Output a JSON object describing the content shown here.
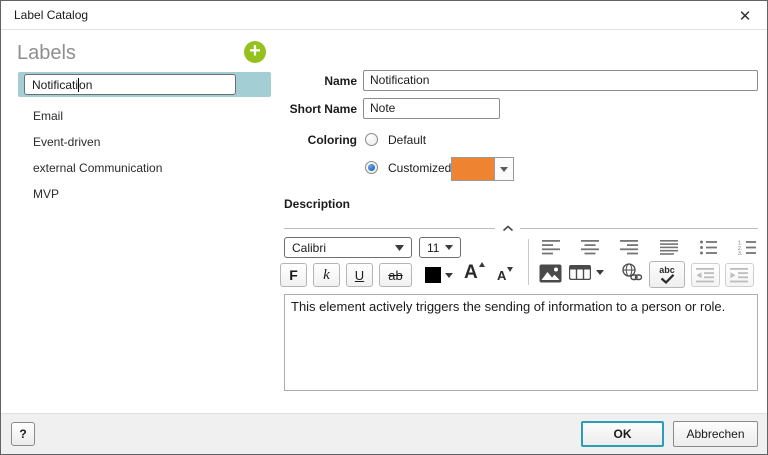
{
  "window": {
    "title": "Label Catalog",
    "close_glyph": "✕"
  },
  "labels_panel": {
    "heading": "Labels",
    "add_glyph": "+",
    "items": [
      "Notification",
      "Email",
      "Event-driven",
      "external Communication",
      "MVP"
    ],
    "selected_item": "Notification",
    "edit_value": "Notification",
    "edit_value_before_caret": "Notificati",
    "edit_value_after_caret": "on"
  },
  "form": {
    "name_label": "Name",
    "name_value": "Notification",
    "short_name_label": "Short Name",
    "short_name_value": "Note",
    "coloring_label": "Coloring",
    "default_option": "Default",
    "customized_option": "Customized",
    "selected_coloring": "Customized",
    "custom_color": "#ee8431",
    "custom_color_style": "background-color:#ee8431;",
    "description_label": "Description"
  },
  "editor": {
    "font_family_value": "Calibri",
    "font_size_value": "11",
    "bold_label": "F",
    "italic_label": "k",
    "underline_label": "U",
    "strikethrough_label": "ab",
    "increase_font_label": "A",
    "decrease_font_label": "A",
    "spellcheck_label": "abc",
    "text_color": "#000000",
    "description_text": "This element actively triggers the sending of information to a person or role."
  },
  "footer": {
    "help_label": "?",
    "ok_label": "OK",
    "cancel_label": "Abbrechen"
  },
  "colors": {
    "selection_teal": "#a3ced3",
    "add_button_green": "#95c11f",
    "ok_border_teal": "#2a9fb4"
  }
}
